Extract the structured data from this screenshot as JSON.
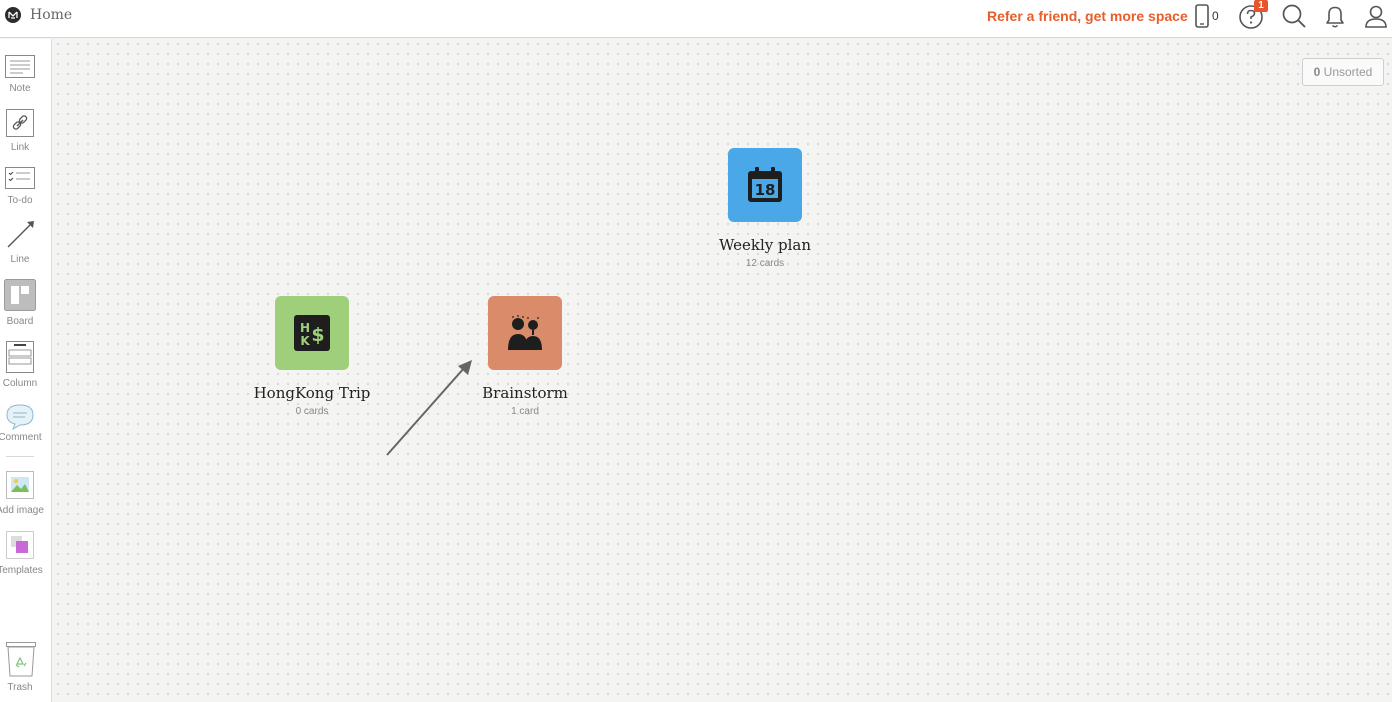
{
  "topbar": {
    "title": "Home",
    "refer_label": "Refer a friend, get more space",
    "device_count": "0",
    "help_badge": "1",
    "icons": [
      "logo-icon",
      "phone-icon",
      "help-icon",
      "search-icon",
      "bell-icon",
      "user-icon"
    ]
  },
  "sidebar": {
    "tools": [
      {
        "label": "Note",
        "icon": "note-icon"
      },
      {
        "label": "Link",
        "icon": "link-icon"
      },
      {
        "label": "To-do",
        "icon": "todo-icon"
      },
      {
        "label": "Line",
        "icon": "line-icon"
      },
      {
        "label": "Board",
        "icon": "board-icon"
      },
      {
        "label": "Column",
        "icon": "column-icon"
      },
      {
        "label": "Comment",
        "icon": "comment-icon"
      },
      {
        "label": "Add image",
        "icon": "image-icon"
      },
      {
        "label": "Templates",
        "icon": "templates-icon"
      },
      {
        "label": "Trash",
        "icon": "trash-icon"
      }
    ]
  },
  "canvas": {
    "unsorted": {
      "count": "0",
      "label": "Unsorted"
    },
    "boards": [
      {
        "name": "Weekly plan",
        "count": "12 cards",
        "color": "#4aa8e8",
        "icon": "calendar-icon",
        "day": "18"
      },
      {
        "name": "HongKong Trip",
        "count": "0 cards",
        "color": "#9fcf7a",
        "icon": "hk-dollar-icon"
      },
      {
        "name": "Brainstorm",
        "count": "1 card",
        "color": "#d98b6a",
        "icon": "brainstorm-icon"
      }
    ]
  }
}
